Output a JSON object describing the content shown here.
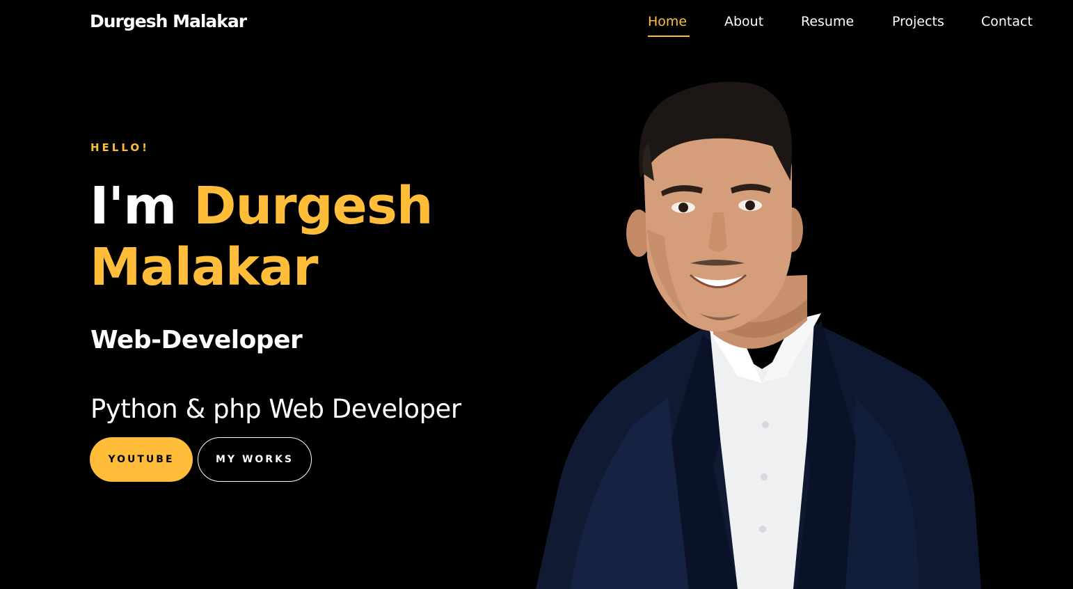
{
  "navbar": {
    "brand": "Durgesh Malakar",
    "items": [
      {
        "label": "Home",
        "active": true
      },
      {
        "label": "About",
        "active": false
      },
      {
        "label": "Resume",
        "active": false
      },
      {
        "label": "Projects",
        "active": false
      },
      {
        "label": "Contact",
        "active": false
      }
    ]
  },
  "hero": {
    "greeting": "HELLO!",
    "intro": "I'm",
    "name_first": "Durgesh",
    "name_last": "Malakar",
    "role": "Web-Developer",
    "tagline": "Python & php Web Developer",
    "buttons": {
      "primary": "YOUTUBE",
      "secondary": "MY WORKS"
    },
    "portrait": "portrait-photo"
  },
  "colors": {
    "background": "#000000",
    "accent": "#ffbd39",
    "text": "#ffffff"
  }
}
